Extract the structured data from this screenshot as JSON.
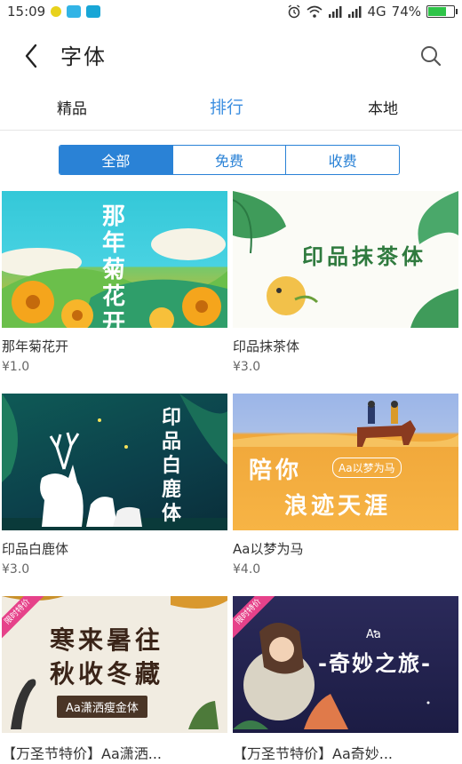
{
  "status_bar": {
    "time": "15:09",
    "network": "4G",
    "battery_percent": "74%",
    "battery_level": 0.74
  },
  "header": {
    "title": "字体"
  },
  "tabs": [
    {
      "label": "精品"
    },
    {
      "label": "排行"
    },
    {
      "label": "本地"
    }
  ],
  "segment": [
    {
      "label": "全部"
    },
    {
      "label": "免费"
    },
    {
      "label": "收费"
    }
  ],
  "fonts": [
    {
      "name": "那年菊花开",
      "price": "¥1.0",
      "cover_text": "那年菊花开"
    },
    {
      "name": "印品抹茶体",
      "price": "¥3.0",
      "cover_text": "印品抹茶体"
    },
    {
      "name": "印品白鹿体",
      "price": "¥3.0",
      "cover_text": "印品白鹿体"
    },
    {
      "name": "Aa以梦为马",
      "price": "¥4.0",
      "cover_text_1": "陪你",
      "cover_text_2": "浪迹天涯",
      "cover_tag": "Aa以梦为马"
    },
    {
      "name": "【万圣节特价】Aa潇洒...",
      "ribbon": "限时特价",
      "cover_text_1": "寒来暑往",
      "cover_text_2": "秋收冬藏",
      "cover_tag": "Aa潇洒瘦金体"
    },
    {
      "name": "【万圣节特价】Aa奇妙...",
      "ribbon": "限时特价",
      "cover_small": "Aa",
      "cover_text": "-奇妙之旅-"
    }
  ],
  "colors": {
    "accent": "#2a82d6",
    "tab_active": "#3b8ee0",
    "battery": "#2ec448",
    "ribbon": "#e6428a"
  },
  "icons": [
    "back-arrow-icon",
    "search-icon",
    "alarm-icon",
    "wifi-icon",
    "signal-icon",
    "battery-icon"
  ]
}
